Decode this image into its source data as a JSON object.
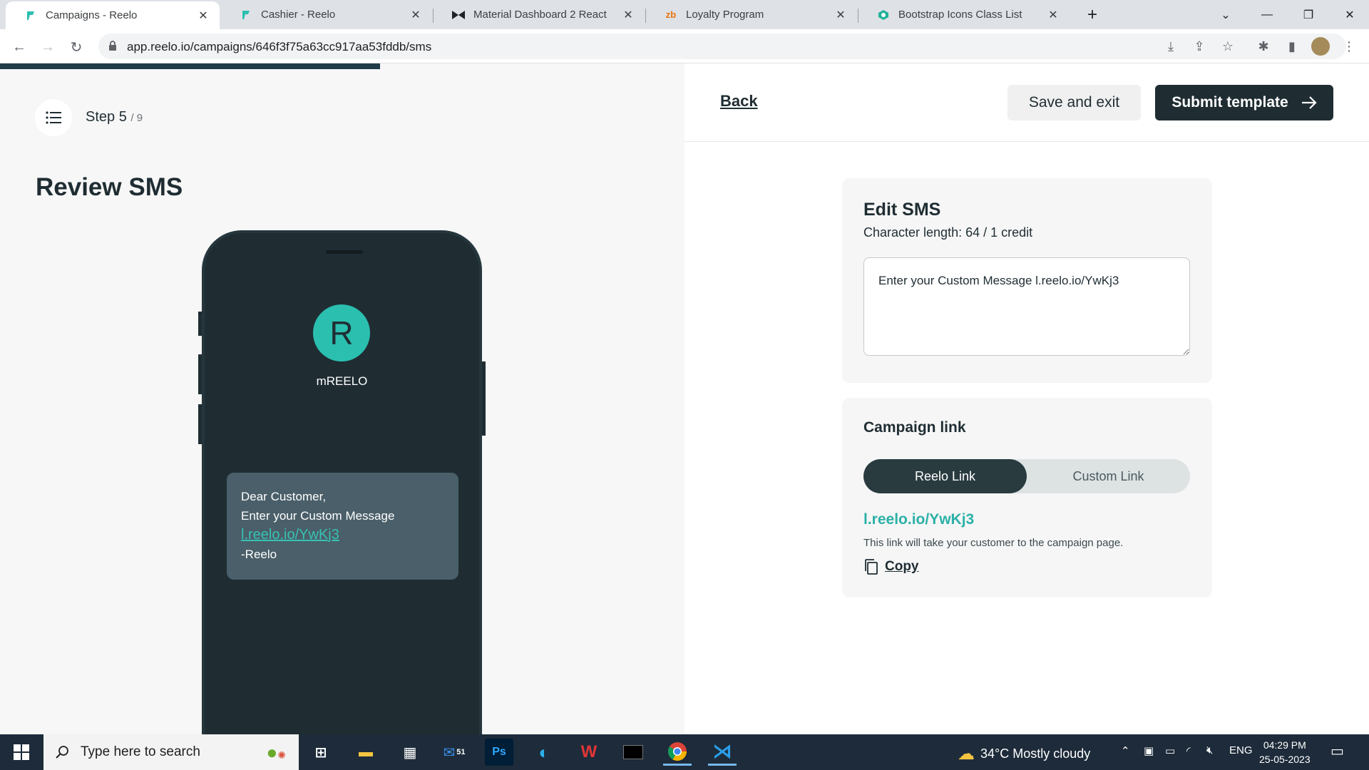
{
  "browser": {
    "tabs": [
      {
        "title": "Campaigns - Reelo",
        "active": true
      },
      {
        "title": "Cashier - Reelo",
        "active": false
      },
      {
        "title": "Material Dashboard 2 React",
        "active": false
      },
      {
        "title": "Loyalty Program",
        "active": false
      },
      {
        "title": "Bootstrap Icons Class List",
        "active": false
      }
    ],
    "url": "app.reelo.io/campaigns/646f3f75a63cc917aa53fddb/sms"
  },
  "wizard": {
    "progress_fraction": 0.555,
    "step_label": "Step 5",
    "step_total": "/ 9",
    "title": "Review SMS"
  },
  "preview": {
    "avatar_letter": "R",
    "sender": "mREELO",
    "message_line1": "Dear Customer,",
    "message_line2": "Enter your Custom Message",
    "message_link": "l.reelo.io/YwKj3",
    "message_sign": "-Reelo"
  },
  "actions": {
    "back": "Back",
    "save_exit": "Save and exit",
    "submit": "Submit template"
  },
  "edit_sms": {
    "title": "Edit SMS",
    "char_length": "Character length: 64 / 1 credit",
    "text": "Enter your Custom Message l.reelo.io/YwKj3"
  },
  "campaign_link": {
    "title": "Campaign link",
    "options": [
      "Reelo Link",
      "Custom Link"
    ],
    "selected": "Reelo Link",
    "link": "l.reelo.io/YwKj3",
    "help": "This link will take your customer to the campaign page.",
    "copy": "Copy"
  },
  "taskbar": {
    "search_placeholder": "Type here to search",
    "mail_badge": "51",
    "weather": "34°C  Mostly cloudy",
    "language": "ENG",
    "time": "04:29 PM",
    "date": "25-05-2023"
  },
  "colors": {
    "primary_dark": "#1f2d33",
    "accent_teal": "#2bb0a8"
  }
}
